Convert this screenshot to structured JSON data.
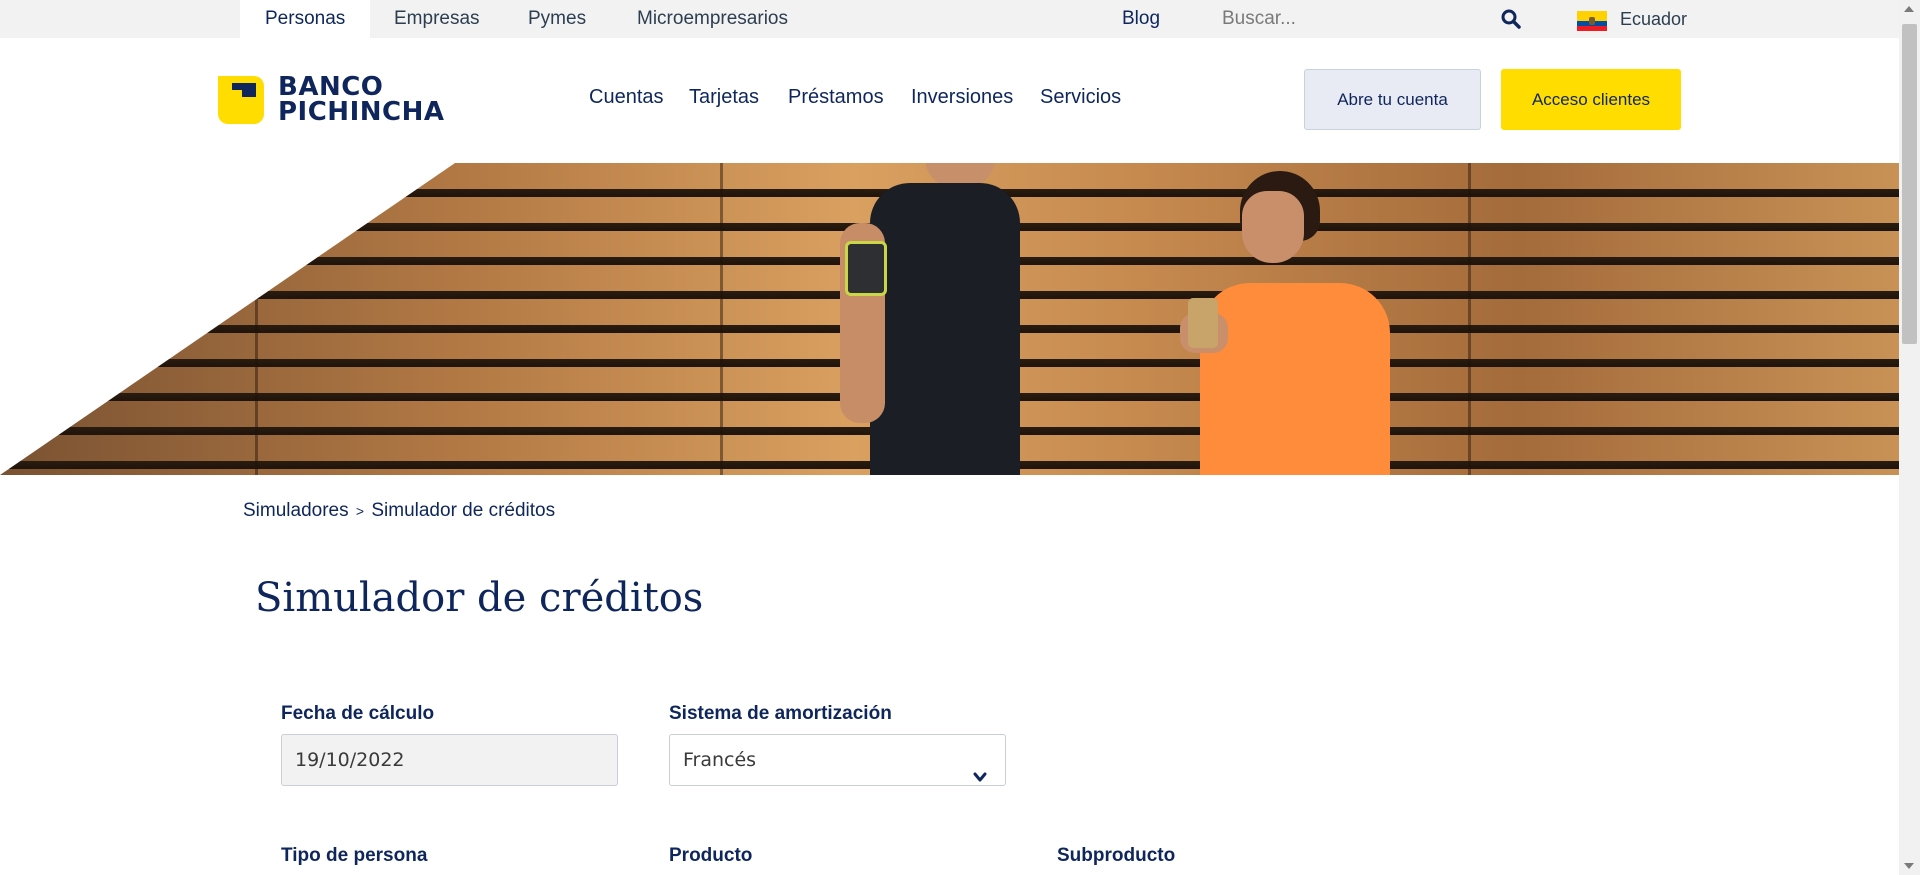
{
  "topbar": {
    "segments": [
      "Personas",
      "Empresas",
      "Pymes",
      "Microempresarios"
    ],
    "blog": "Blog",
    "search_placeholder": "Buscar...",
    "search_icon": "search-icon",
    "country": "Ecuador",
    "country_flag": "ecuador-flag-icon"
  },
  "header": {
    "logo_line1": "BANCO",
    "logo_line2": "PICHINCHA",
    "nav": [
      "Cuentas",
      "Tarjetas",
      "Préstamos",
      "Inversiones",
      "Servicios"
    ],
    "open_account_label": "Abre tu cuenta",
    "client_access_label": "Acceso clientes"
  },
  "hero": {
    "image_alt": "Dos personas sonriendo mirando un teléfono frente a una pared de madera"
  },
  "breadcrumb": {
    "parent": "Simuladores",
    "separator": ">",
    "current": "Simulador de créditos"
  },
  "page": {
    "title": "Simulador de créditos"
  },
  "form": {
    "fecha_label": "Fecha de cálculo",
    "fecha_value": "19/10/2022",
    "sistema_label": "Sistema de amortización",
    "sistema_value": "Francés",
    "tipo_persona_label": "Tipo de persona",
    "producto_label": "Producto",
    "subproducto_label": "Subproducto"
  },
  "colors": {
    "brand_yellow": "#ffdd00",
    "brand_navy": "#0f265c",
    "button_secondary_bg": "#e8ebf3"
  }
}
